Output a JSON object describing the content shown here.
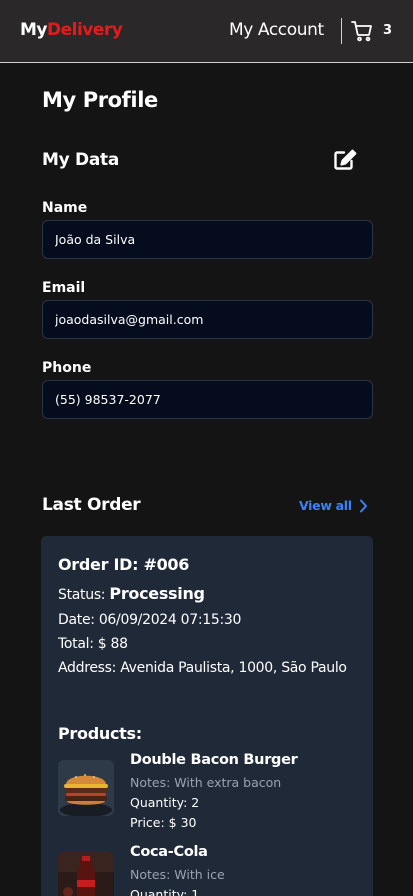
{
  "navbar": {
    "brand_part1": "My",
    "brand_part2": "Delivery",
    "account_label": "My Account",
    "cart_icon": "cart-icon",
    "cart_count": "3"
  },
  "profile": {
    "title": "My Profile",
    "data_title": "My Data",
    "edit_icon": "edit-icon",
    "fields": [
      {
        "label": "Name",
        "value": "João da Silva"
      },
      {
        "label": "Email",
        "value": "joaodasilva@gmail.com"
      },
      {
        "label": "Phone",
        "value": "(55) 98537-2077"
      }
    ]
  },
  "last_order": {
    "title": "Last Order",
    "view_all_label": "View all",
    "view_all_icon": "chevron-right-icon",
    "order_id": "Order ID: #006",
    "status_label": "Status: ",
    "status_value": "Processing",
    "date": "Date: 06/09/2024 07:15:30",
    "total": "Total: $ 88",
    "address": "Address: Avenida Paulista, 1000, São Paulo",
    "products_title": "Products:",
    "products": [
      {
        "name": "Double Bacon Burger",
        "notes": "Notes: With extra bacon",
        "quantity": "Quantity: 2",
        "price": "Price: $ 30"
      },
      {
        "name": "Coca-Cola",
        "notes": "Notes: With ice",
        "quantity": "Quantity: 1",
        "price": ""
      }
    ]
  },
  "colors": {
    "accent_red": "#e51b1b",
    "link_blue": "#3b82f6",
    "card_bg": "#1f2937",
    "input_bg": "#050c1e"
  }
}
